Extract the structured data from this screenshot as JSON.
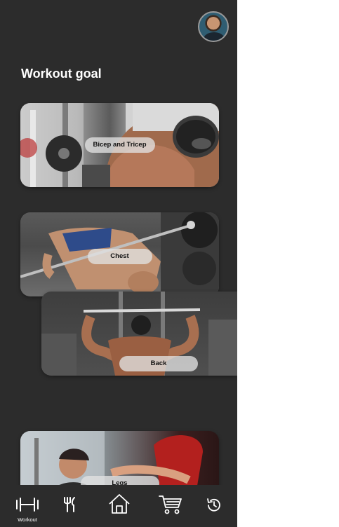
{
  "header": {
    "title": "Workout goal"
  },
  "workouts": [
    {
      "label": "Bicep and Tricep"
    },
    {
      "label": "Chest"
    },
    {
      "label": "Back"
    },
    {
      "label": "Legs"
    }
  ],
  "nav": {
    "items": [
      {
        "icon": "dumbbell-icon",
        "label": "Workout",
        "active": true
      },
      {
        "icon": "fork-knife-icon",
        "label": ""
      },
      {
        "icon": "home-icon",
        "label": ""
      },
      {
        "icon": "cart-icon",
        "label": ""
      },
      {
        "icon": "history-icon",
        "label": ""
      }
    ]
  },
  "colors": {
    "background": "#2c2c2c",
    "text": "#ffffff",
    "pill": "#e1e1e1"
  }
}
